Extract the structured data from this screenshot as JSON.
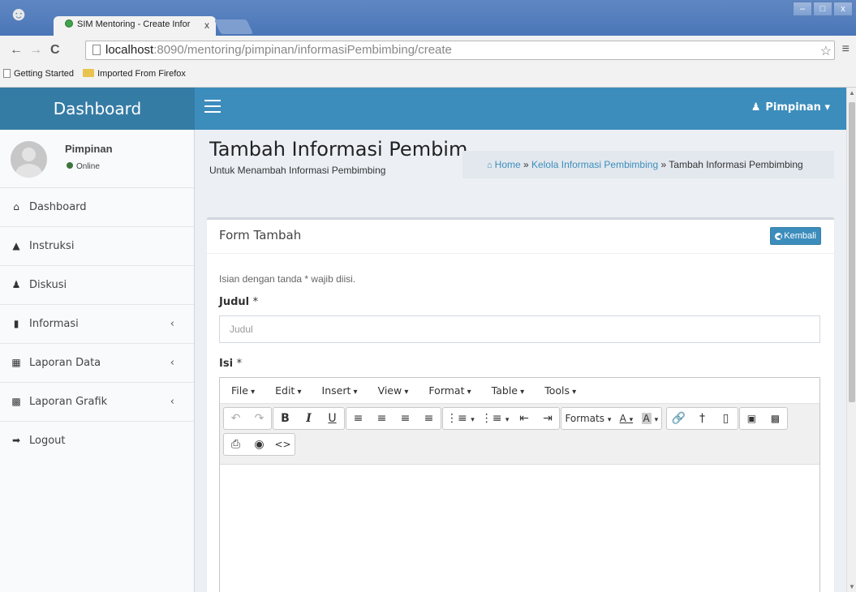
{
  "browser": {
    "tab_title": "SIM Mentoring - Create Infor",
    "tab_close": "x",
    "url_host": "localhost",
    "url_rest": ":8090/mentoring/pimpinan/informasiPembimbing/create",
    "bookmarks": [
      "Getting Started",
      "Imported From Firefox"
    ]
  },
  "app": {
    "brand": "Dashboard",
    "user_menu": "Pimpinan"
  },
  "sidebar": {
    "user_name": "Pimpinan",
    "user_status": "Online",
    "items": [
      {
        "label": "Dashboard",
        "icon": "home-icon",
        "has_children": false
      },
      {
        "label": "Instruksi",
        "icon": "warning-icon",
        "has_children": false
      },
      {
        "label": "Diskusi",
        "icon": "users-icon",
        "has_children": false
      },
      {
        "label": "Informasi",
        "icon": "file-icon",
        "has_children": true
      },
      {
        "label": "Laporan Data",
        "icon": "book-icon",
        "has_children": true
      },
      {
        "label": "Laporan Grafik",
        "icon": "bar-chart-icon",
        "has_children": true
      },
      {
        "label": "Logout",
        "icon": "sign-out-icon",
        "has_children": false
      }
    ]
  },
  "header": {
    "title": "Tambah Informasi Pembimbing",
    "subtitle": "Untuk Menambah Informasi Pembimbing",
    "breadcrumb": [
      "Home",
      "Kelola Informasi Pembimbing",
      "Tambah Informasi Pembimbing"
    ],
    "breadcrumb_sep": "»"
  },
  "form": {
    "box_title": "Form Tambah",
    "back_label": "Kembali",
    "note": "Isian dengan tanda * wajib diisi.",
    "judul_label": "Judul",
    "isi_label": "Isi",
    "required_mark": "*",
    "judul_placeholder": "Judul",
    "judul_value": ""
  },
  "editor": {
    "menus": [
      "File",
      "Edit",
      "Insert",
      "View",
      "Format",
      "Table",
      "Tools"
    ],
    "formats_label": "Formats",
    "content": ""
  },
  "colors": {
    "navbar": "#3c8dbc",
    "logo": "#357ca5",
    "accent": "#3c8dbc"
  }
}
